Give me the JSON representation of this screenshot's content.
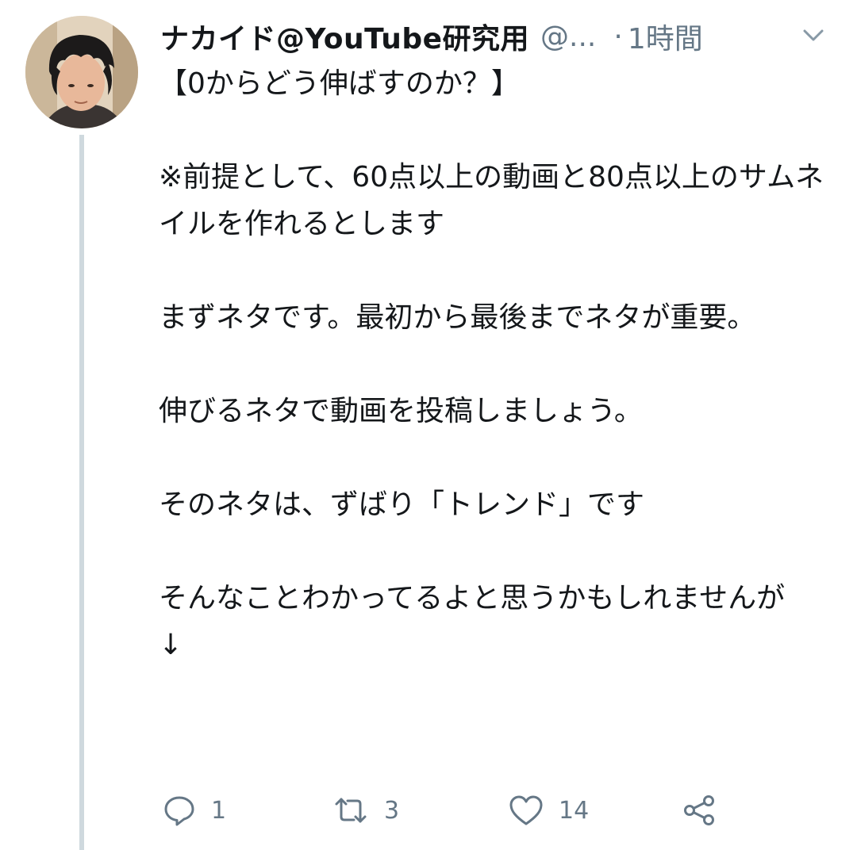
{
  "tweet": {
    "display_name": "ナカイド@YouTube研究用",
    "handle": "@...",
    "separator": "·",
    "time": "1時間",
    "body": "【0からどう伸ばすのか？】\n\n※前提として、60点以上の動画と80点以上のサムネイルを作れるとします\n\nまずネタです。最初から最後までネタが重要。\n\n伸びるネタで動画を投稿しましょう。\n\nそのネタは、ずばり「トレンド」です\n\nそんなことわかってるよと思うかもしれませんが\n↓"
  },
  "actions": {
    "reply": {
      "icon": "reply-icon",
      "count": "1"
    },
    "retweet": {
      "icon": "retweet-icon",
      "count": "3"
    },
    "like": {
      "icon": "heart-icon",
      "count": "14"
    },
    "share": {
      "icon": "share-icon"
    }
  },
  "colors": {
    "text": "#14171a",
    "secondary": "#657786",
    "thread_line": "#cfd9de"
  }
}
